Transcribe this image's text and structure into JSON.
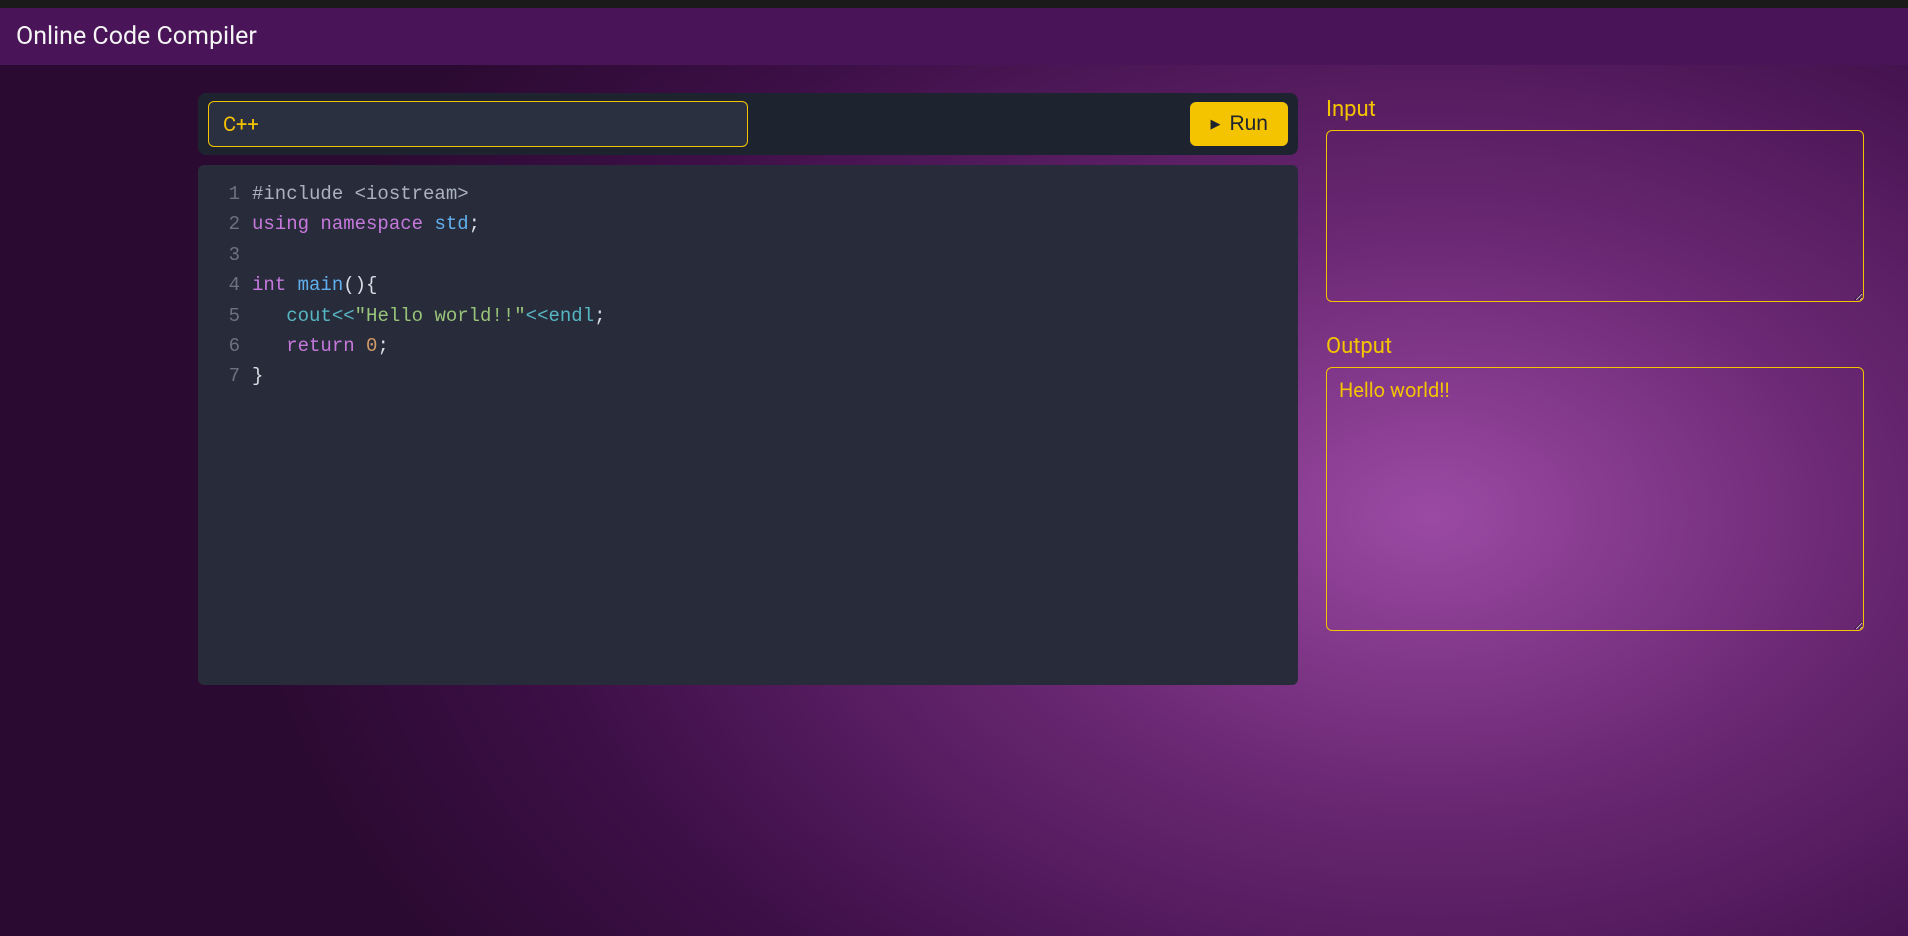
{
  "header": {
    "title": "Online Code Compiler"
  },
  "toolbar": {
    "language": "C++",
    "run_label": "Run"
  },
  "editor": {
    "lines": [
      [
        {
          "t": "preproc",
          "v": "#include <iostream>"
        }
      ],
      [
        {
          "t": "keyword",
          "v": "using"
        },
        {
          "t": "plain",
          "v": " "
        },
        {
          "t": "keyword",
          "v": "namespace"
        },
        {
          "t": "plain",
          "v": " "
        },
        {
          "t": "ident",
          "v": "std"
        },
        {
          "t": "punct",
          "v": ";"
        }
      ],
      [],
      [
        {
          "t": "type",
          "v": "int"
        },
        {
          "t": "plain",
          "v": " "
        },
        {
          "t": "func",
          "v": "main"
        },
        {
          "t": "punct",
          "v": "(){"
        }
      ],
      [
        {
          "t": "plain",
          "v": "   "
        },
        {
          "t": "obj",
          "v": "cout"
        },
        {
          "t": "op",
          "v": "<<"
        },
        {
          "t": "string",
          "v": "\"Hello world!!\""
        },
        {
          "t": "op",
          "v": "<<"
        },
        {
          "t": "obj",
          "v": "endl"
        },
        {
          "t": "punct",
          "v": ";"
        }
      ],
      [
        {
          "t": "plain",
          "v": "   "
        },
        {
          "t": "keyword",
          "v": "return"
        },
        {
          "t": "plain",
          "v": " "
        },
        {
          "t": "number",
          "v": "0"
        },
        {
          "t": "punct",
          "v": ";"
        }
      ],
      [
        {
          "t": "punct",
          "v": "}"
        }
      ]
    ]
  },
  "io": {
    "input_label": "Input",
    "input_value": "",
    "output_label": "Output",
    "output_value": "Hello world!!"
  }
}
